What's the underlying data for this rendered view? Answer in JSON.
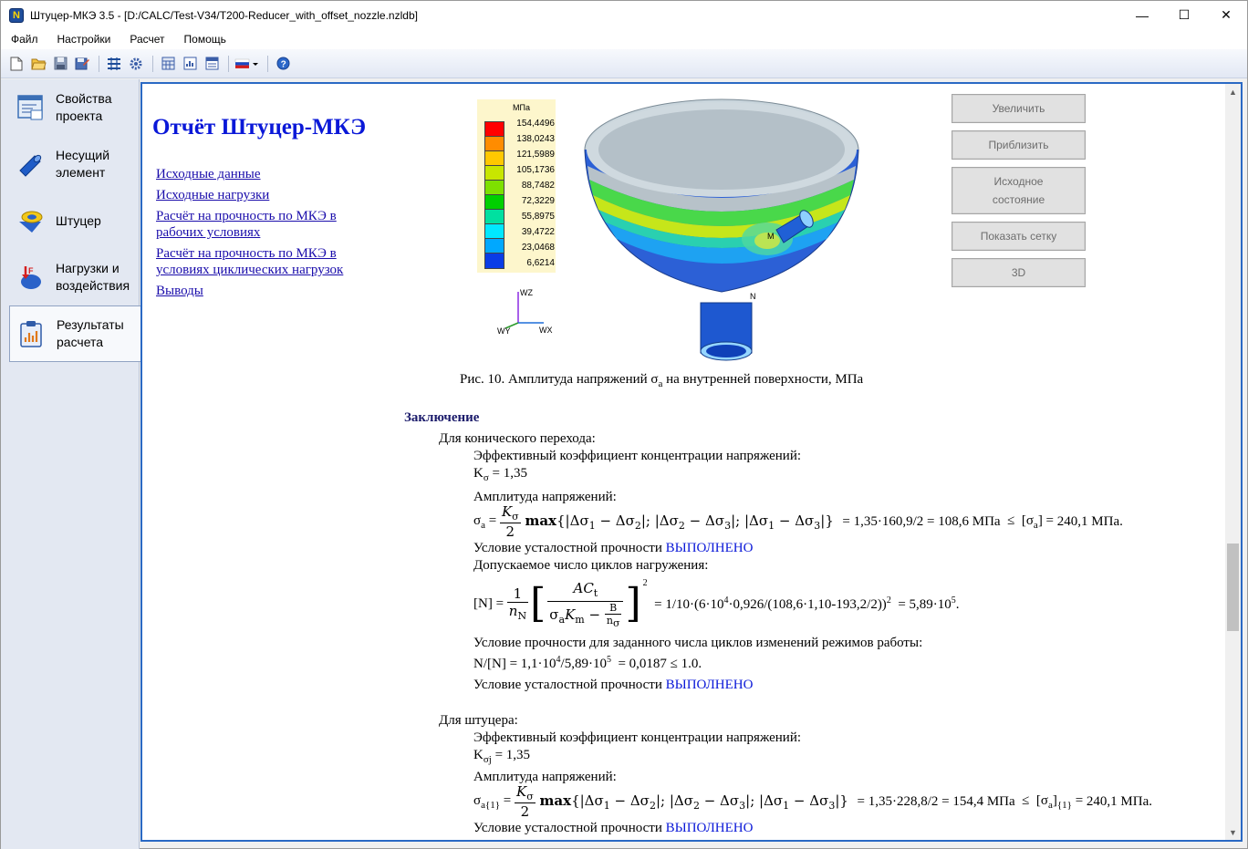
{
  "window": {
    "title": "Штуцер-МКЭ 3.5 - [D:/CALC/Test-V34/T200-Reducer_with_offset_nozzle.nzldb]",
    "app_icon_letter": "N",
    "minimize": "—",
    "maximize": "☐",
    "close": "✕"
  },
  "menu": [
    "Файл",
    "Настройки",
    "Расчет",
    "Помощь"
  ],
  "toolbar": {
    "icons": [
      "new-file-icon",
      "open-folder-icon",
      "save-icon",
      "save-as-icon",
      "calculate-icon",
      "settings-icon",
      "calculator-icon",
      "report-icon",
      "table-icon",
      "language-flag-icon",
      "help-icon"
    ]
  },
  "sidebar": {
    "items": [
      {
        "label": "Свойства\nпроекта",
        "icon": "project-properties-icon",
        "active": false
      },
      {
        "label": "Несущий\nэлемент",
        "icon": "shell-element-icon",
        "active": false
      },
      {
        "label": "Штуцер",
        "icon": "nozzle-icon",
        "active": false
      },
      {
        "label": "Нагрузки и\nвоздействия",
        "icon": "loads-icon",
        "active": false
      },
      {
        "label": "Результаты\nрасчета",
        "icon": "results-icon",
        "active": true
      }
    ]
  },
  "report": {
    "title": "Отчёт Штуцер-МКЭ",
    "toc": [
      "Исходные данные",
      "Исходные нагрузки",
      "Расчёт на прочность по МКЭ в рабочих условиях",
      "Расчёт на прочность по МКЭ в условиях циклических нагрузок",
      "Выводы"
    ],
    "legend": {
      "unit": "МПа",
      "values": [
        "154,4496",
        "138,0243",
        "121,5989",
        "105,1736",
        "88,7482",
        "72,3229",
        "55,8975",
        "39,4722",
        "23,0468",
        "6,6214"
      ],
      "colors": [
        "#ff0000",
        "#ff8c00",
        "#ffc800",
        "#c8e600",
        "#7ee000",
        "#00d000",
        "#00e0a0",
        "#00e8ff",
        "#00a8ff",
        "#0a3ce6"
      ]
    },
    "axes": {
      "z": "WZ",
      "y": "WY",
      "x": "WX"
    },
    "model_labels": {
      "m": "M",
      "n": "N"
    },
    "buttons": [
      "Увеличить",
      "Приблизить",
      "Исходное\nсостояние",
      "Показать сетку",
      "3D"
    ],
    "caption": {
      "prefix": "Рис. 10. Амплитуда напряжений σ",
      "sub": "a",
      "suffix": " на внутренней поверхности, МПа"
    },
    "conclusion": {
      "heading": "Заключение",
      "cone_title": "Для конического перехода:",
      "kconc_label": "Эффективный коэффициент концентрации напряжений:",
      "k_sigma": "= 1,35",
      "amp_label": "Амплитуда напряжений:",
      "amp_formula_tail": "= 1,35·160,9/2 = 108,6 МПа",
      "amp_allow": "240,1 МПа.",
      "cond_text": "Условие усталостной прочности",
      "cond_status": "ВЫПОЛНЕНО",
      "cycles_label": "Допускаемое число циклов нагружения:",
      "cycles_formula": "= 1/10·(6·10",
      "cycles_formula2": "·0,926/(108,6·1,10-193,2/2))",
      "cycles_result": "= 5,89·10",
      "cycles_result_exp": "5",
      "cycles_label2": "Условие прочности для заданного числа циклов изменений режимов работы:",
      "ratio": "N/[N] = 1,1·10",
      "ratio2": "/5,89·10",
      "ratio3": "= 0,0187 ≤ 1.0.",
      "nozzle_title": "Для штуцера:",
      "k_sigma_j": "= 1,35",
      "amp2_formula_tail": "= 1,35·228,8/2 = 154,4 МПа",
      "amp2_allow": "240,1 МПа."
    }
  }
}
